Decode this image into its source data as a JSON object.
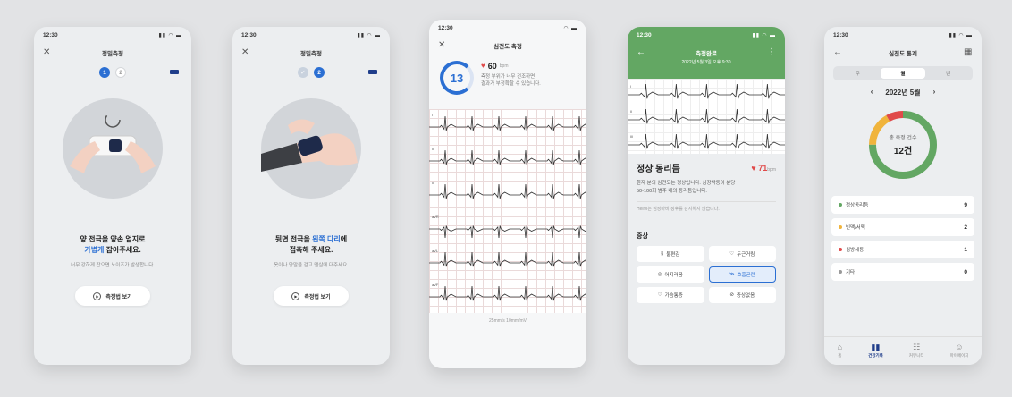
{
  "colors": {
    "accent": "#2b6fd3",
    "green": "#63a763",
    "heart": "#e04a4a"
  },
  "phone1": {
    "time": "12:30",
    "title": "정밀측정",
    "steps": [
      "1",
      "2"
    ],
    "line1": "양 전극을 양손 엄지로",
    "line2a": "가볍게",
    "line2b": " 잡아주세요.",
    "sub": "너무 강하게 잡으면 노이즈가 발생합니다.",
    "button": "측정법 보기"
  },
  "phone2": {
    "time": "12:30",
    "title": "정밀측정",
    "step2": "2",
    "line1a": "뒷면 전극을 ",
    "line1b": "왼쪽 다리",
    "line1c": "에",
    "line2": "접촉해 주세요.",
    "sub": "옷이나 양말을 걷고 맨살에 대주세요.",
    "button": "측정법 보기"
  },
  "phone3": {
    "time": "12:30",
    "title": "심전도 측정",
    "countdown": "13",
    "bpm": "60",
    "bpm_unit": "bpm",
    "warn1": "측정 부위가 너무 건조하면",
    "warn2": "결과가 부정확할 수 있습니다.",
    "leads": [
      "I",
      "II",
      "III",
      "aVR",
      "aVL",
      "aVF"
    ],
    "speed": "25mm/s 10mm/mV"
  },
  "phone4": {
    "time": "12:30",
    "title": "측정완료",
    "date": "2022년 5월 3일 오후 9:30",
    "leads": [
      "I",
      "II",
      "III"
    ],
    "result": "정상 동리듬",
    "bpm": "71",
    "bpm_unit": "bpm",
    "desc1": "환자 분의 심전도는 정상입니다. 심장박동이 분당",
    "desc2": "50-100회 범주 내의 동리듬입니다.",
    "note": "Hellvi는 심장마비 징후를 감지하지 않습니다.",
    "symptom_title": "증상",
    "symptoms": [
      "불편감",
      "두근거림",
      "어지러움",
      "호흡곤란",
      "가슴통증",
      "증상없음"
    ]
  },
  "phone5": {
    "time": "12:30",
    "title": "심전도 통계",
    "segments": [
      "주",
      "월",
      "년"
    ],
    "month": "2022년 5월",
    "total_label": "총 측정 건수",
    "total_value": "12건",
    "stats": [
      {
        "label": "정상동리듬",
        "value": "9",
        "color": "#63a763"
      },
      {
        "label": "빈맥/서맥",
        "value": "2",
        "color": "#f0b43c"
      },
      {
        "label": "심방세동",
        "value": "1",
        "color": "#e04a4a"
      },
      {
        "label": "기타",
        "value": "0",
        "color": "#999999"
      }
    ],
    "tabs": [
      "홈",
      "건강기록",
      "커뮤니티",
      "마이페이지"
    ]
  }
}
